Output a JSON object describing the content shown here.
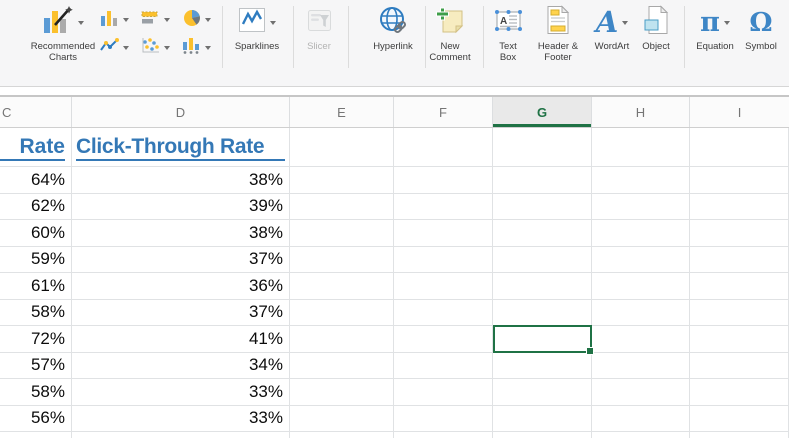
{
  "toolbar": {
    "recommended_charts": "Recommended Charts",
    "sparklines": "Sparklines",
    "slicer": "Slicer",
    "hyperlink": "Hyperlink",
    "new_comment": "New Comment",
    "text_box": "Text Box",
    "header_footer": "Header & Footer",
    "wordart": "WordArt",
    "object": "Object",
    "equation": "Equation",
    "symbol": "Symbol",
    "chart_type_buttons": [
      "column-chart",
      "bar-chart",
      "pie-chart",
      "line-chart",
      "scatter-chart",
      "combo-chart"
    ],
    "equation_glyph": "π",
    "symbol_glyph": "Ω",
    "wordart_glyph": "A"
  },
  "sheet": {
    "columns": [
      "C",
      "D",
      "E",
      "F",
      "G",
      "H",
      "I"
    ],
    "selected_column": "G",
    "headers": {
      "rate": "Rate",
      "ctr": "Click-Through Rate"
    },
    "rows": [
      {
        "rate": "64%",
        "ctr": "38%"
      },
      {
        "rate": "62%",
        "ctr": "39%"
      },
      {
        "rate": "60%",
        "ctr": "38%"
      },
      {
        "rate": "59%",
        "ctr": "37%"
      },
      {
        "rate": "61%",
        "ctr": "36%"
      },
      {
        "rate": "58%",
        "ctr": "37%"
      },
      {
        "rate": "72%",
        "ctr": "41%"
      },
      {
        "rate": "57%",
        "ctr": "34%"
      },
      {
        "rate": "58%",
        "ctr": "33%"
      },
      {
        "rate": "56%",
        "ctr": "33%"
      }
    ],
    "selection": {
      "column": "G",
      "adjacent_row_values": {
        "rate": "72%",
        "ctr": "41%"
      }
    }
  },
  "colors": {
    "excel_green": "#1f7245",
    "link_blue": "#3478b6"
  }
}
